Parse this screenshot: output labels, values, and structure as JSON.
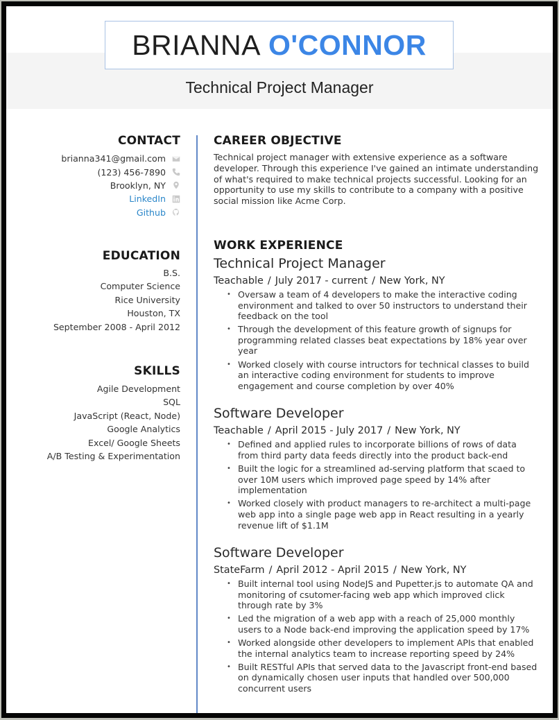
{
  "header": {
    "first_name": "BRIANNA",
    "last_name": "O'CONNOR",
    "headline": "Technical Project Manager"
  },
  "colors": {
    "accent": "#3c86e6",
    "divider": "#6188c8",
    "link": "#2a86c9",
    "band": "#f4f4f4",
    "icon": "#c9c9c9"
  },
  "contact": {
    "title": "CONTACT",
    "items": [
      {
        "text": "brianna341@gmail.com",
        "icon": "envelope-icon",
        "link": false
      },
      {
        "text": "(123) 456-7890",
        "icon": "phone-icon",
        "link": false
      },
      {
        "text": "Brooklyn, NY",
        "icon": "map-pin-icon",
        "link": false
      },
      {
        "text": "LinkedIn",
        "icon": "linkedin-icon",
        "link": true
      },
      {
        "text": "Github",
        "icon": "github-icon",
        "link": true
      }
    ]
  },
  "education": {
    "title": "EDUCATION",
    "lines": [
      "B.S.",
      "Computer Science",
      "Rice University",
      "Houston, TX",
      "September 2008 - April 2012"
    ]
  },
  "skills": {
    "title": "SKILLS",
    "items": [
      "Agile Development",
      "SQL",
      "JavaScript (React, Node)",
      "Google Analytics",
      "Excel/ Google Sheets",
      "A/B Testing & Experimentation"
    ]
  },
  "objective": {
    "title": "CAREER OBJECTIVE",
    "text": "Technical project manager with extensive experience as a software developer. Through this experience I've gained an intimate understanding of what's required to make technical projects successful. Looking for an opportunity to use my skills to contribute to a company with a positive social mission like Acme Corp."
  },
  "experience": {
    "title": "WORK EXPERIENCE",
    "separator": "/",
    "jobs": [
      {
        "title": "Technical Project Manager",
        "company": "Teachable",
        "dates": "July 2017 - current",
        "location": "New York, NY",
        "bullets": [
          "Oversaw a team of 4 developers to make the interactive coding environment and talked to over 50 instructors to understand their feedback on the tool",
          "Through the development of this feature growth of signups for programming related classes beat expectations by 18% year over year",
          "Worked closely with course intructors for technical classes to build an interactive coding environment for students to improve engagement and course completion by over 40%"
        ]
      },
      {
        "title": "Software Developer",
        "company": "Teachable",
        "dates": "April 2015 - July 2017",
        "location": "New York, NY",
        "bullets": [
          "Defined and applied rules to incorporate billions of rows of data from third party data feeds directly into the product back-end",
          "Built the logic for a streamlined ad-serving platform that scaed to over 10M users which improved page speed by 14% after implementation",
          "Worked closely with product managers to re-architect a multi-page web app into a single page web app in React resulting in a yearly revenue lift of $1.1M"
        ]
      },
      {
        "title": "Software Developer",
        "company": "StateFarm",
        "dates": "April 2012 - April 2015",
        "location": "New York, NY",
        "bullets": [
          "Built internal tool using NodeJS and Pupetter.js to automate QA and monitoring of csutomer-facing web app which improved click through rate by 3%",
          "Led the migration of a web app with a reach of 25,000 monthly users to a Node back-end improving the application speed by 17%",
          "Worked alongside other developers to implement APIs that enabled the internal analytics team to increase reporting speed by 24%",
          "Built RESTful APIs that served data to the Javascript front-end based on dynamically chosen user inputs that handled over 500,000 concurrent users"
        ]
      }
    ]
  }
}
